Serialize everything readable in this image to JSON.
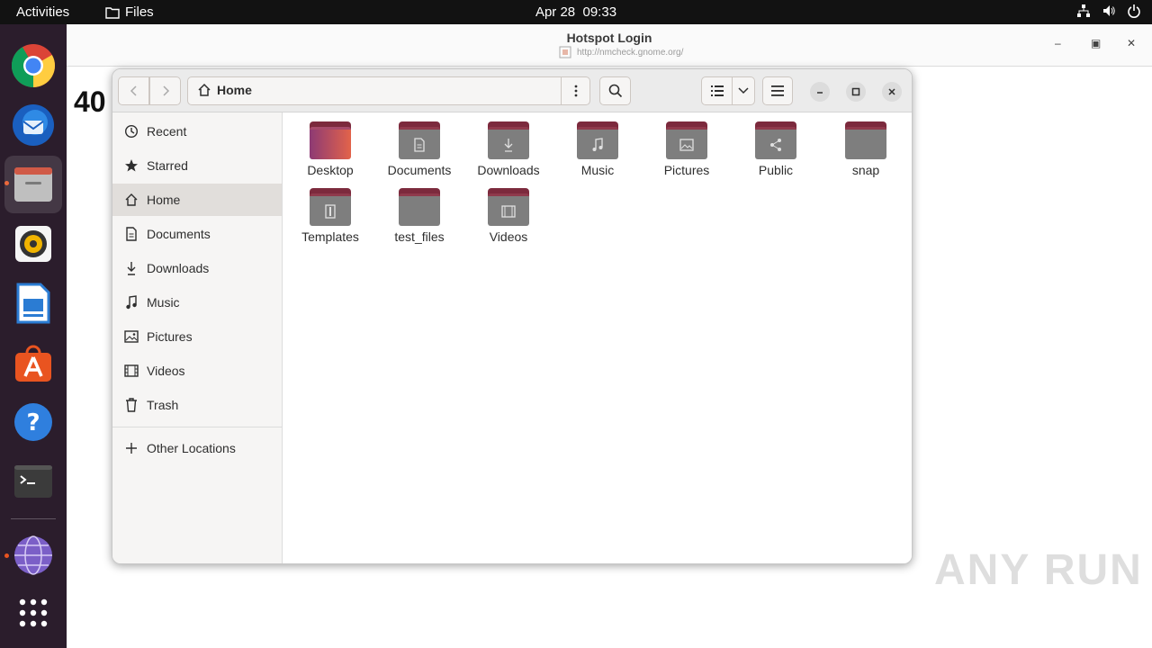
{
  "topbar": {
    "activities": "Activities",
    "app_name": "Files",
    "date": "Apr 28",
    "time": "09:33"
  },
  "dock": {
    "items": [
      {
        "name": "chrome-icon"
      },
      {
        "name": "thunderbird-icon"
      },
      {
        "name": "files-icon"
      },
      {
        "name": "rhythmbox-icon"
      },
      {
        "name": "libreoffice-writer-icon"
      },
      {
        "name": "app-center-icon"
      },
      {
        "name": "help-icon"
      },
      {
        "name": "terminal-icon"
      },
      {
        "name": "network-browser-icon"
      },
      {
        "name": "show-apps-icon"
      }
    ]
  },
  "browser": {
    "title": "Hotspot Login",
    "url": "http://nmcheck.gnome.org/",
    "page_text": "40"
  },
  "files": {
    "path": "Home",
    "sidebar": [
      {
        "label": "Recent",
        "icon": "clock-icon"
      },
      {
        "label": "Starred",
        "icon": "star-icon"
      },
      {
        "label": "Home",
        "icon": "home-icon",
        "selected": true
      },
      {
        "label": "Documents",
        "icon": "document-icon"
      },
      {
        "label": "Downloads",
        "icon": "download-icon"
      },
      {
        "label": "Music",
        "icon": "music-icon"
      },
      {
        "label": "Pictures",
        "icon": "picture-icon"
      },
      {
        "label": "Videos",
        "icon": "video-icon"
      },
      {
        "label": "Trash",
        "icon": "trash-icon"
      }
    ],
    "other_locations": "Other Locations",
    "folders": [
      {
        "label": "Desktop",
        "icon": "desktop-folder-icon"
      },
      {
        "label": "Documents",
        "icon": "documents-folder-icon"
      },
      {
        "label": "Downloads",
        "icon": "downloads-folder-icon"
      },
      {
        "label": "Music",
        "icon": "music-folder-icon"
      },
      {
        "label": "Pictures",
        "icon": "pictures-folder-icon"
      },
      {
        "label": "Public",
        "icon": "public-folder-icon"
      },
      {
        "label": "snap",
        "icon": "folder-icon"
      },
      {
        "label": "Templates",
        "icon": "templates-folder-icon"
      },
      {
        "label": "test_files",
        "icon": "folder-icon"
      },
      {
        "label": "Videos",
        "icon": "videos-folder-icon"
      }
    ]
  },
  "watermark": "ANY RUN",
  "colors": {
    "topbar_bg": "#121212",
    "dock_bg": "#2b1d2c",
    "accent": "#e95420",
    "folder_tab": "#7c2a3d"
  }
}
